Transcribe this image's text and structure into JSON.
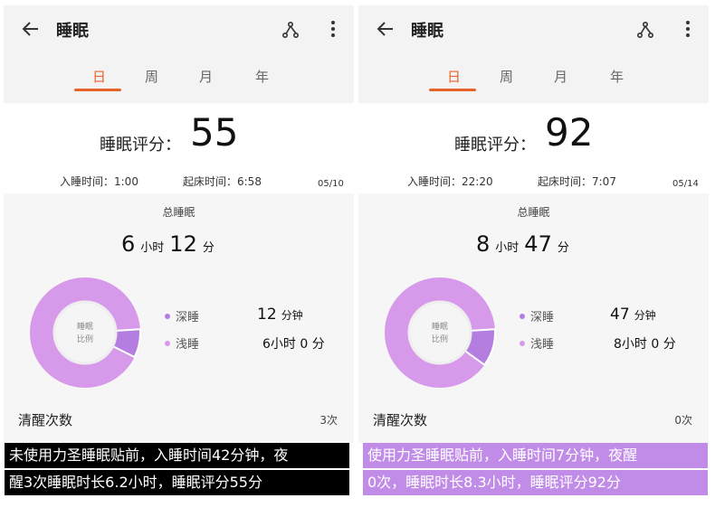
{
  "left": {
    "title": "睡眠",
    "tabs": [
      "日",
      "周",
      "月",
      "年"
    ],
    "score_label": "睡眠评分：",
    "score": "55",
    "sleep_time": "入睡时间：1:00",
    "wake_time": "起床时间：6:58",
    "date": "05/10",
    "total_label": "总睡眠",
    "total_hours": "6",
    "hour_unit": "小时",
    "total_minutes": "12",
    "minute_unit": "分",
    "donut_label_1": "睡眠",
    "donut_label_2": "比例",
    "deep_label": "深睡",
    "deep_num": "12",
    "deep_unit": "分钟",
    "light_label": "浅睡",
    "light_value": "6小时 0 分",
    "wake_count_label": "清醒次数",
    "wake_count": "3次",
    "deep_fraction": 0.0323,
    "caption_line1": "未使用力圣睡眠贴前，入睡时间42分钟，夜",
    "caption_line2": "醒3次睡眠时长6.2小时，睡眠评分55分"
  },
  "right": {
    "title": "睡眠",
    "tabs": [
      "日",
      "周",
      "月",
      "年"
    ],
    "score_label": "睡眠评分：",
    "score": "92",
    "sleep_time": "入睡时间：22:20",
    "wake_time": "起床时间：7:07",
    "date": "05/14",
    "total_label": "总睡眠",
    "total_hours": "8",
    "hour_unit": "小时",
    "total_minutes": "47",
    "minute_unit": "分",
    "donut_label_1": "睡眠",
    "donut_label_2": "比例",
    "deep_label": "深睡",
    "deep_num": "47",
    "deep_unit": "分钟",
    "light_label": "浅睡",
    "light_value": "8小时 0 分",
    "wake_count_label": "清醒次数",
    "wake_count": "0次",
    "deep_fraction": 0.0892,
    "caption_line1": "使用力圣睡眠贴前，入睡时间7分钟，夜醒",
    "caption_line2": "0次，睡眠时长8.3小时，睡眠评分92分"
  },
  "colors": {
    "accent": "#e8632b",
    "deep_sleep": "#b47de0",
    "light_sleep": "#d79aea",
    "caption_left_bg": "#000000",
    "caption_right_bg": "#c18ce8"
  },
  "icons": {
    "back": "arrow-left-icon",
    "share": "share-icon",
    "more": "more-vertical-icon"
  }
}
